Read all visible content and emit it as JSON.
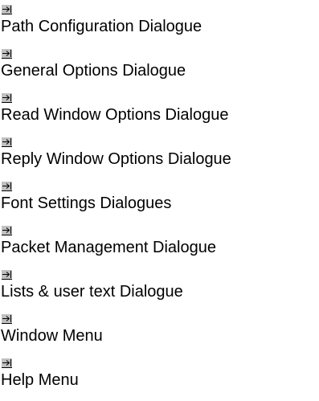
{
  "topics": [
    {
      "icon": "jump-arrow-icon",
      "label": "Path Configuration Dialogue"
    },
    {
      "icon": "jump-arrow-icon",
      "label": "General Options Dialogue"
    },
    {
      "icon": "jump-arrow-icon",
      "label": "Read Window Options Dialogue"
    },
    {
      "icon": "jump-arrow-icon",
      "label": "Reply Window Options Dialogue"
    },
    {
      "icon": "jump-arrow-icon",
      "label": "Font Settings Dialogues"
    },
    {
      "icon": "jump-arrow-icon",
      "label": "Packet Management Dialogue"
    },
    {
      "icon": "jump-arrow-icon",
      "label": "Lists & user text Dialogue"
    },
    {
      "icon": "jump-arrow-icon",
      "label": "Window Menu"
    },
    {
      "icon": "jump-arrow-icon",
      "label": "Help Menu"
    }
  ],
  "colors": {
    "background": "#ffffff",
    "text": "#000000",
    "icon_fill": "#c0c0c0",
    "icon_stroke": "#000000"
  }
}
